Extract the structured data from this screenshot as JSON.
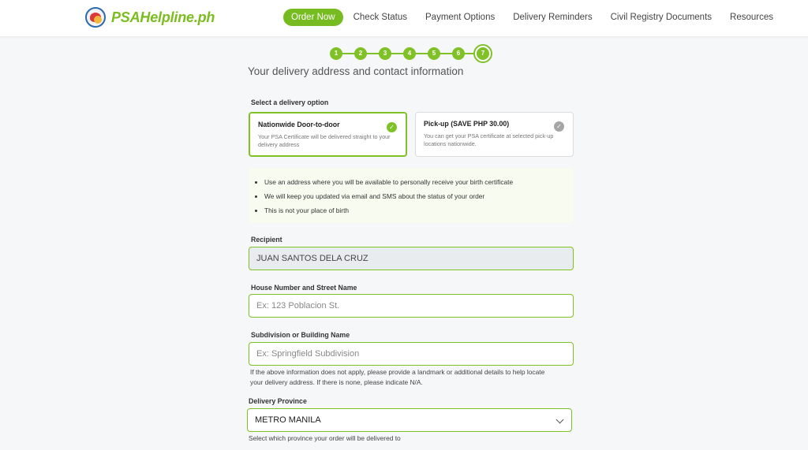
{
  "brand": {
    "name": "PSAHelpline.ph"
  },
  "nav": {
    "items": [
      {
        "label": "Order Now"
      },
      {
        "label": "Check Status"
      },
      {
        "label": "Payment Options"
      },
      {
        "label": "Delivery Reminders"
      },
      {
        "label": "Civil Registry Documents"
      },
      {
        "label": "Resources"
      }
    ],
    "active_index": 0
  },
  "stepper": {
    "steps": [
      "1",
      "2",
      "3",
      "4",
      "5",
      "6",
      "7"
    ],
    "current": 7
  },
  "page": {
    "heading": "Your delivery address and contact information"
  },
  "delivery": {
    "label": "Select a delivery option",
    "options": [
      {
        "title": "Nationwide Door-to-door",
        "description": "Your PSA Certificate will be delivered straight to your delivery address",
        "selected": true
      },
      {
        "title": "Pick-up (SAVE PHP 30.00)",
        "description": "You can get your PSA certificate at selected pick-up locations nationwide.",
        "selected": false
      }
    ]
  },
  "info": {
    "items": [
      "Use an address where you will be available to personally receive your birth certificate",
      "We will keep you updated via email and SMS about the status of your order",
      "This is not your place of birth"
    ]
  },
  "form": {
    "recipient": {
      "label": "Recipient",
      "value": "JUAN SANTOS DELA CRUZ"
    },
    "street": {
      "label": "House Number and Street Name",
      "placeholder": "Ex: 123 Poblacion St."
    },
    "subdivision": {
      "label": "Subdivision or Building Name",
      "placeholder": "Ex: Springfield Subdivision",
      "hint_line1": "If the above information does not apply, please provide a landmark or additional details to help locate",
      "hint_line2": "your delivery address. If there is none, please indicate N/A."
    },
    "province": {
      "label": "Delivery Province",
      "value": "METRO MANILA",
      "hint": "Select which province your order will be delivered to"
    }
  },
  "colors": {
    "accent": "#7fc127",
    "brand_text": "#7bbd1e"
  }
}
